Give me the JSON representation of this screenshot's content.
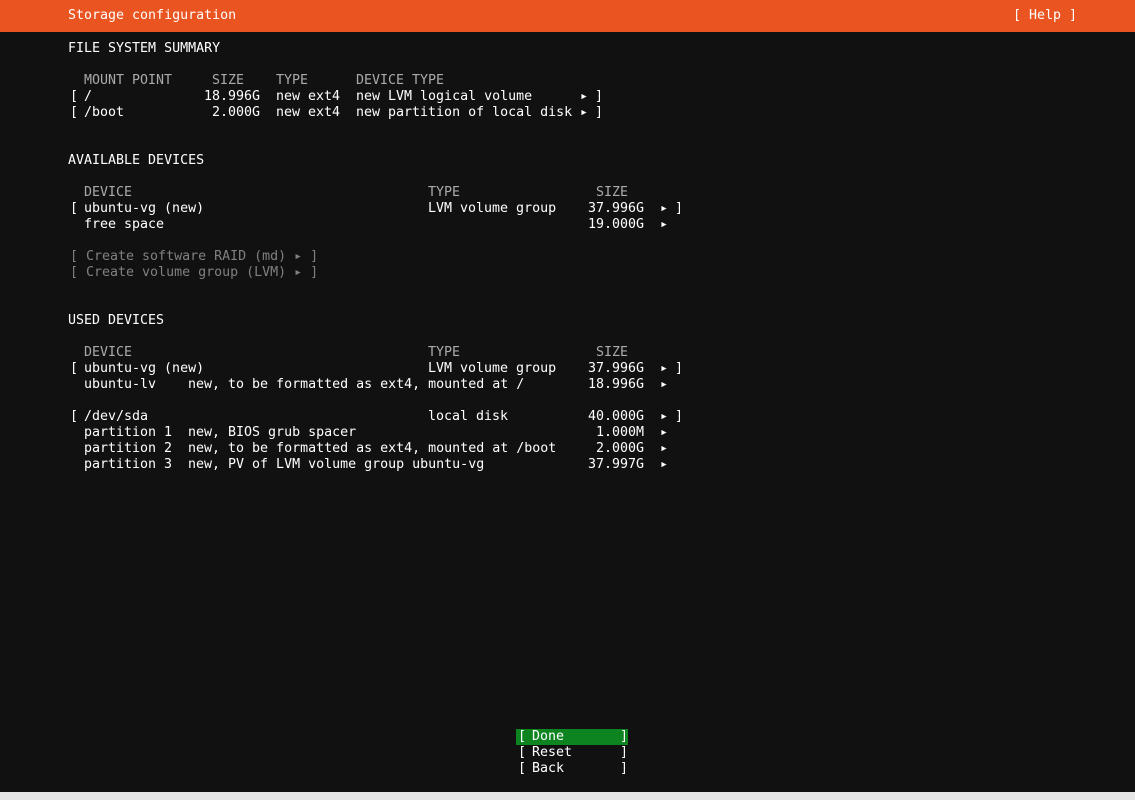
{
  "header": {
    "title": "Storage configuration",
    "help": "[ Help ]"
  },
  "fs_summary": {
    "heading": "FILE SYSTEM SUMMARY",
    "columns": {
      "mount": "MOUNT POINT",
      "size": "SIZE",
      "type": "TYPE",
      "device_type": "DEVICE TYPE"
    },
    "rows": [
      {
        "open": "[",
        "mount": "/",
        "size": "18.996G",
        "type": "new ext4",
        "device_type": "new LVM logical volume",
        "arrow": "▸",
        "close": "]"
      },
      {
        "open": "[",
        "mount": "/boot",
        "size": "2.000G",
        "type": "new ext4",
        "device_type": "new partition of local disk",
        "arrow": "▸",
        "close": "]"
      }
    ]
  },
  "available": {
    "heading": "AVAILABLE DEVICES",
    "columns": {
      "device": "DEVICE",
      "type": "TYPE",
      "size": "SIZE"
    },
    "rows": [
      {
        "open": "[",
        "device": "ubuntu-vg (new)",
        "type": "LVM volume group",
        "size": "37.996G",
        "arrow": "▸",
        "close": "]"
      },
      {
        "device": "free space",
        "size": "19.000G",
        "arrow": "▸"
      }
    ],
    "actions": [
      "[ Create software RAID (md) ▸ ]",
      "[ Create volume group (LVM) ▸ ]"
    ]
  },
  "used": {
    "heading": "USED DEVICES",
    "columns": {
      "device": "DEVICE",
      "type": "TYPE",
      "size": "SIZE"
    },
    "groups": [
      {
        "main": {
          "open": "[",
          "device": "ubuntu-vg (new)",
          "type": "LVM volume group",
          "size": "37.996G",
          "arrow": "▸",
          "close": "]"
        },
        "subs": [
          {
            "device": "ubuntu-lv",
            "desc": "new, to be formatted as ext4, mounted at /",
            "size": "18.996G",
            "arrow": "▸"
          }
        ]
      },
      {
        "main": {
          "open": "[",
          "device": "/dev/sda",
          "type": "local disk",
          "size": "40.000G",
          "arrow": "▸",
          "close": "]"
        },
        "subs": [
          {
            "device": "partition 1",
            "desc": "new, BIOS grub spacer",
            "size": "1.000M",
            "arrow": "▸"
          },
          {
            "device": "partition 2",
            "desc": "new, to be formatted as ext4, mounted at /boot",
            "size": "2.000G",
            "arrow": "▸"
          },
          {
            "device": "partition 3",
            "desc": "new, PV of LVM volume group ubuntu-vg",
            "size": "37.997G",
            "arrow": "▸"
          }
        ]
      }
    ]
  },
  "buttons": {
    "bracket_open": "[",
    "bracket_close": "]",
    "done": "Done",
    "reset": "Reset",
    "back": "Back"
  },
  "colors": {
    "accent": "#e95420",
    "focus": "#0e8420",
    "background": "#111111"
  }
}
